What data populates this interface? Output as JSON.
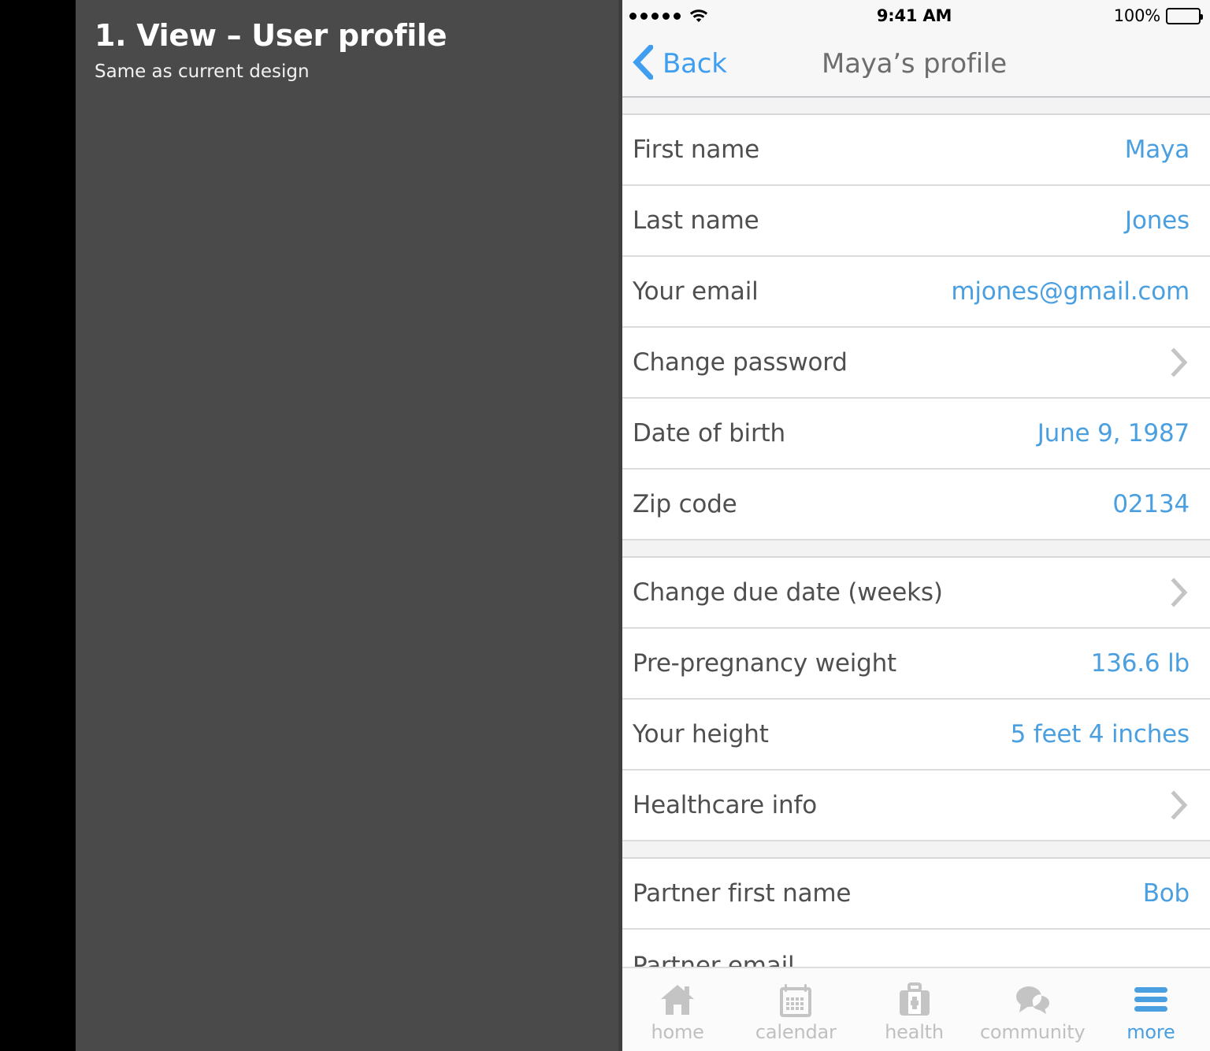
{
  "annotation": {
    "title": "1. View – User profile",
    "subtitle": "Same as current design"
  },
  "colors": {
    "accent_blue": "#4a9fe0",
    "back_blue": "#3f9ef0",
    "panel_gray": "#4a4a4a",
    "label_gray": "#4f4f4f",
    "chevron_gray": "#c4c4c4",
    "tab_inactive": "#c0c0c0"
  },
  "statusbar": {
    "signal_dots": 5,
    "wifi_icon": "wifi-icon",
    "time": "9:41 AM",
    "battery_percent": "100%",
    "battery_icon": "battery-full-icon"
  },
  "navbar": {
    "back_label": "Back",
    "back_icon": "chevron-left-icon",
    "title": "Maya’s profile"
  },
  "sections": [
    {
      "rows": [
        {
          "label": "First name",
          "value": "Maya",
          "type": "value"
        },
        {
          "label": "Last name",
          "value": "Jones",
          "type": "value"
        },
        {
          "label": "Your email",
          "value": "mjones@gmail.com",
          "type": "value"
        },
        {
          "label": "Change password",
          "value": "",
          "type": "disclosure"
        },
        {
          "label": "Date of birth",
          "value": "June 9, 1987",
          "type": "value"
        },
        {
          "label": "Zip code",
          "value": "02134",
          "type": "value"
        }
      ]
    },
    {
      "rows": [
        {
          "label": "Change due date (weeks)",
          "value": "",
          "type": "disclosure"
        },
        {
          "label": "Pre-pregnancy weight",
          "value": "136.6 lb",
          "type": "value"
        },
        {
          "label": "Your height",
          "value": "5 feet 4 inches",
          "type": "value"
        },
        {
          "label": "Healthcare info",
          "value": "",
          "type": "disclosure"
        }
      ]
    },
    {
      "rows": [
        {
          "label": "Partner first name",
          "value": "Bob",
          "type": "value"
        },
        {
          "label": "Partner email",
          "value": "",
          "type": "clipped"
        }
      ]
    }
  ],
  "tabbar": {
    "tabs": [
      {
        "label": "home",
        "icon": "home-icon",
        "active": false
      },
      {
        "label": "calendar",
        "icon": "calendar-icon",
        "active": false
      },
      {
        "label": "health",
        "icon": "medkit-icon",
        "active": false
      },
      {
        "label": "community",
        "icon": "chat-bubbles-icon",
        "active": false
      },
      {
        "label": "more",
        "icon": "hamburger-icon",
        "active": true
      }
    ]
  }
}
